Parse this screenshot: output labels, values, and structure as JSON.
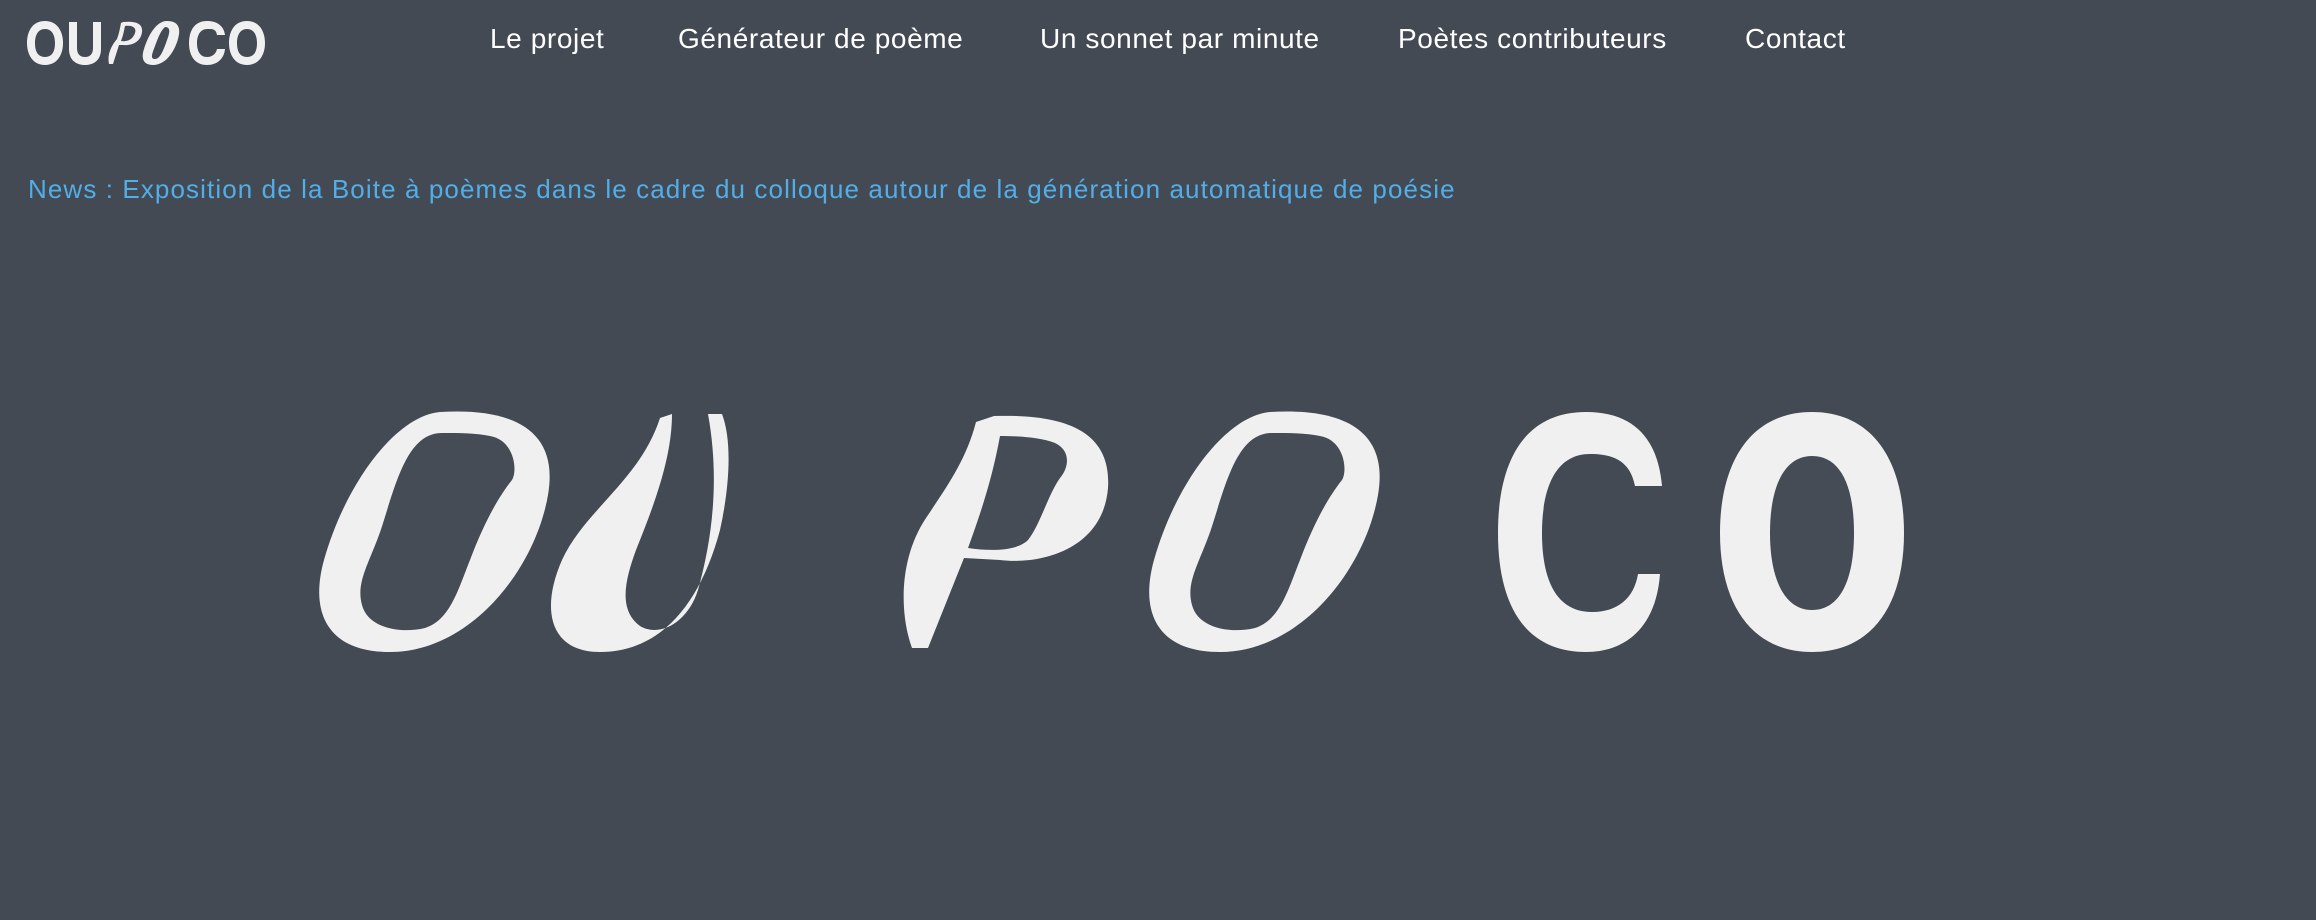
{
  "site": {
    "name": "OUPOCO",
    "logo_letters": [
      "O",
      "U",
      "P",
      "O",
      "C",
      "O"
    ]
  },
  "nav": {
    "items": [
      {
        "label": "Le projet"
      },
      {
        "label": "Générateur de poème"
      },
      {
        "label": "Un sonnet par minute"
      },
      {
        "label": "Poètes contributeurs"
      },
      {
        "label": "Contact"
      }
    ]
  },
  "news": {
    "text": "News : Exposition de la Boite à poèmes dans le cadre du colloque autour de la génération automatique de poésie"
  },
  "colors": {
    "background": "#434a53",
    "nav_text": "#ffffff",
    "news_link": "#52aee8",
    "logo": "#f0f0f0"
  },
  "icons": {
    "header_logo": "oupoco-wordmark",
    "hero_logo": "oupoco-wordmark-large"
  }
}
